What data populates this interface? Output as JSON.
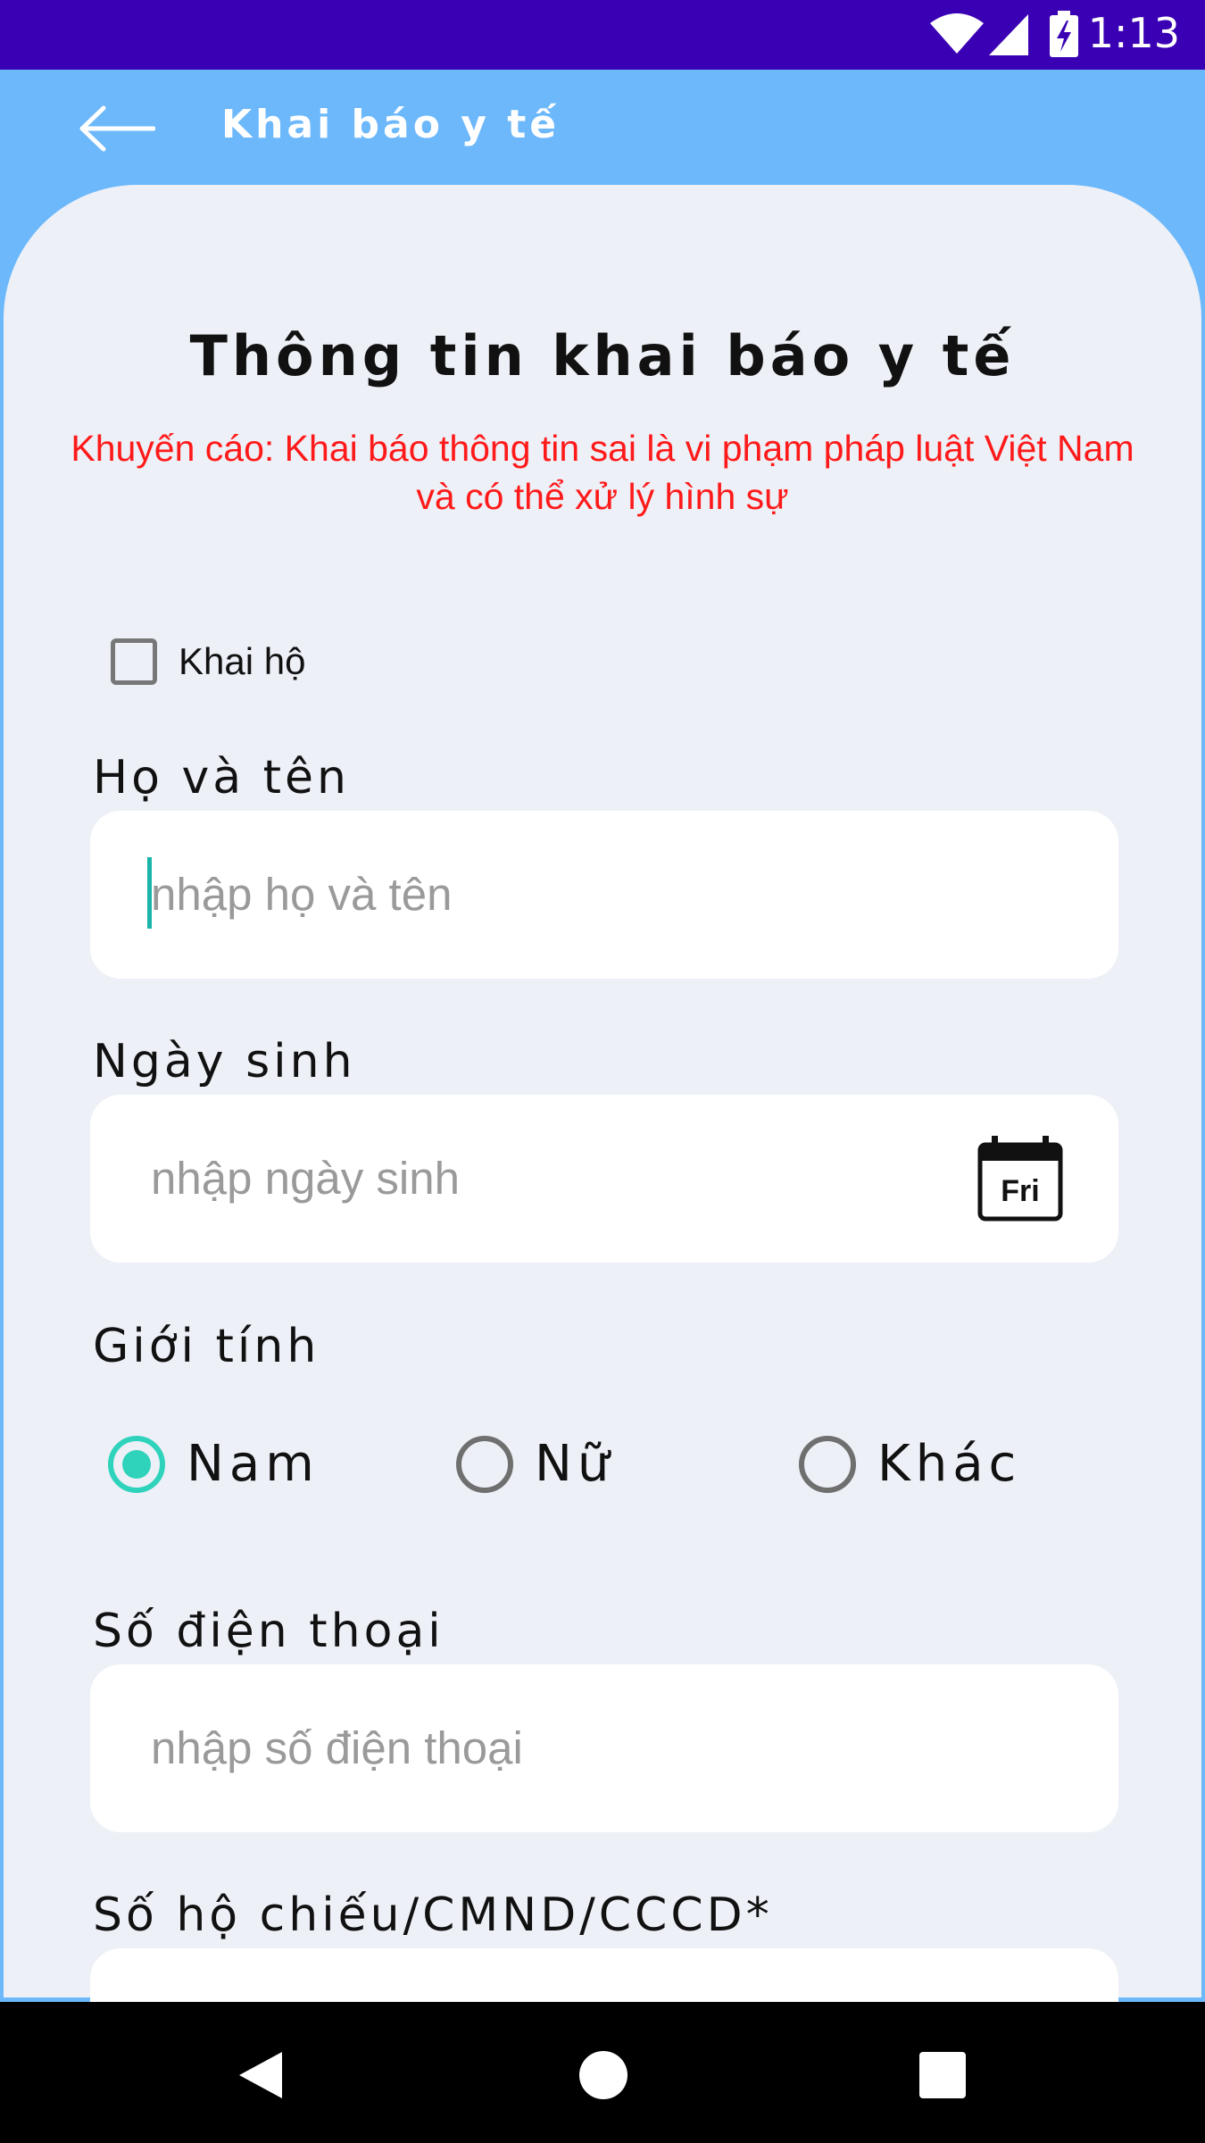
{
  "status_bar": {
    "time": "1:13",
    "icons": [
      "wifi-icon",
      "cellular-signal-icon",
      "battery-charging-icon"
    ]
  },
  "app_bar": {
    "back_icon": "arrow-left-icon",
    "title": "Khai báo y tế"
  },
  "form": {
    "title": "Thông tin khai báo y tế",
    "warning": "Khuyến cáo: Khai báo thông tin sai là vi phạm pháp luật Việt Nam và có thể xử lý hình sự",
    "proxy_checkbox": {
      "label": "Khai hộ",
      "checked": false
    },
    "full_name": {
      "label": "Họ và tên",
      "placeholder": "nhập họ và tên"
    },
    "birth_date": {
      "label": "Ngày sinh",
      "placeholder": "nhập ngày sinh",
      "calendar_icon_text": "Fri"
    },
    "gender": {
      "label": "Giới tính",
      "options": [
        "Nam",
        "Nữ",
        "Khác"
      ],
      "selected": "Nam"
    },
    "phone": {
      "label": "Số điện thoại",
      "placeholder": "nhập số điện thoại"
    },
    "id_number": {
      "label": "Số hộ chiếu/CMND/CCCD*"
    }
  },
  "colors": {
    "status_bar": "#3a00b3",
    "app_bar": "#6cb8fb",
    "card_background": "#edf0f7",
    "warning_text": "#ff1a1a",
    "accent": "#2fd3bb"
  },
  "nav_bar": {
    "icons": [
      "back-triangle-icon",
      "home-circle-icon",
      "recents-square-icon"
    ]
  }
}
